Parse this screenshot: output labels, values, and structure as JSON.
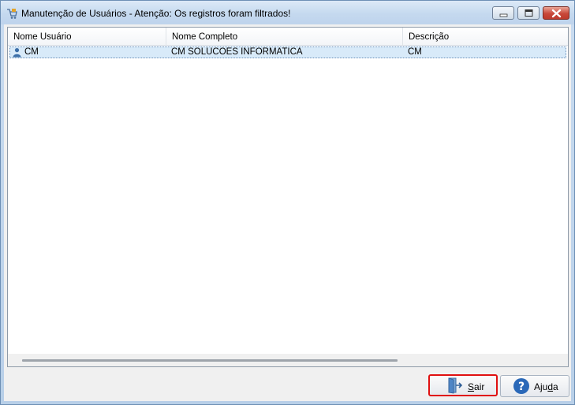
{
  "window": {
    "title": "Manutenção de Usuários - Atenção: Os registros foram filtrados!",
    "icon": "app-icon",
    "controls": [
      "minimize-icon",
      "maximize-icon",
      "close-icon"
    ]
  },
  "list": {
    "columns": [
      {
        "label": "Nome Usuário"
      },
      {
        "label": "Nome Completo"
      },
      {
        "label": "Descrição"
      }
    ],
    "rows": [
      {
        "icon": "user-icon",
        "nome_usuario": "CM",
        "nome_completo": "CM SOLUCOES INFORMATICA",
        "descricao": "CM",
        "selected": true
      }
    ]
  },
  "buttons": {
    "sair": {
      "label": "Sair",
      "mnemonic": "S",
      "rest": "air",
      "icon": "exit-door-icon"
    },
    "ajuda": {
      "label": "Ajuda",
      "prefix": "Aju",
      "mnemonic": "d",
      "rest": "a",
      "icon": "help-icon"
    }
  },
  "colors": {
    "selection": "#d8eaf9",
    "highlight_border": "#e01010",
    "title_gradient": "#c5d9ef"
  }
}
